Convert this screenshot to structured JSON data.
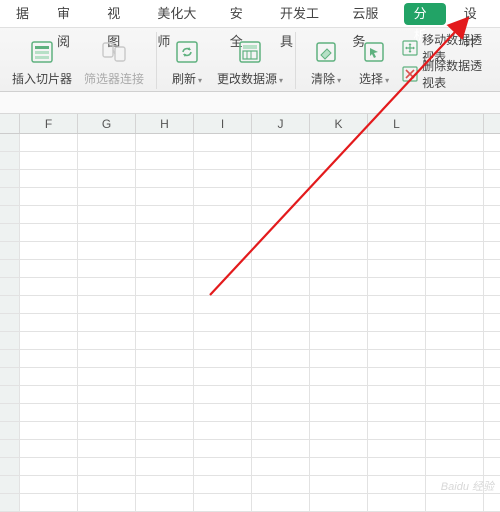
{
  "tabs": {
    "data": "据",
    "review": "审阅",
    "view": "视图",
    "beautify": "美化大师",
    "security": "安全",
    "devtools": "开发工具",
    "cloud": "云服务",
    "analysis": "分析",
    "design": "设计"
  },
  "ribbon": {
    "insert_slicer": "插入切片器",
    "filter_connect": "筛选器连接",
    "refresh": "刷新",
    "change_source": "更改数据源",
    "clear": "清除",
    "select": "选择",
    "move_pivot": "移动数据透视表",
    "delete_pivot": "删除数据透视表"
  },
  "columns": [
    "F",
    "G",
    "H",
    "I",
    "J",
    "K",
    "L",
    ""
  ],
  "chart_data": null,
  "watermark": "Baidu 经验"
}
